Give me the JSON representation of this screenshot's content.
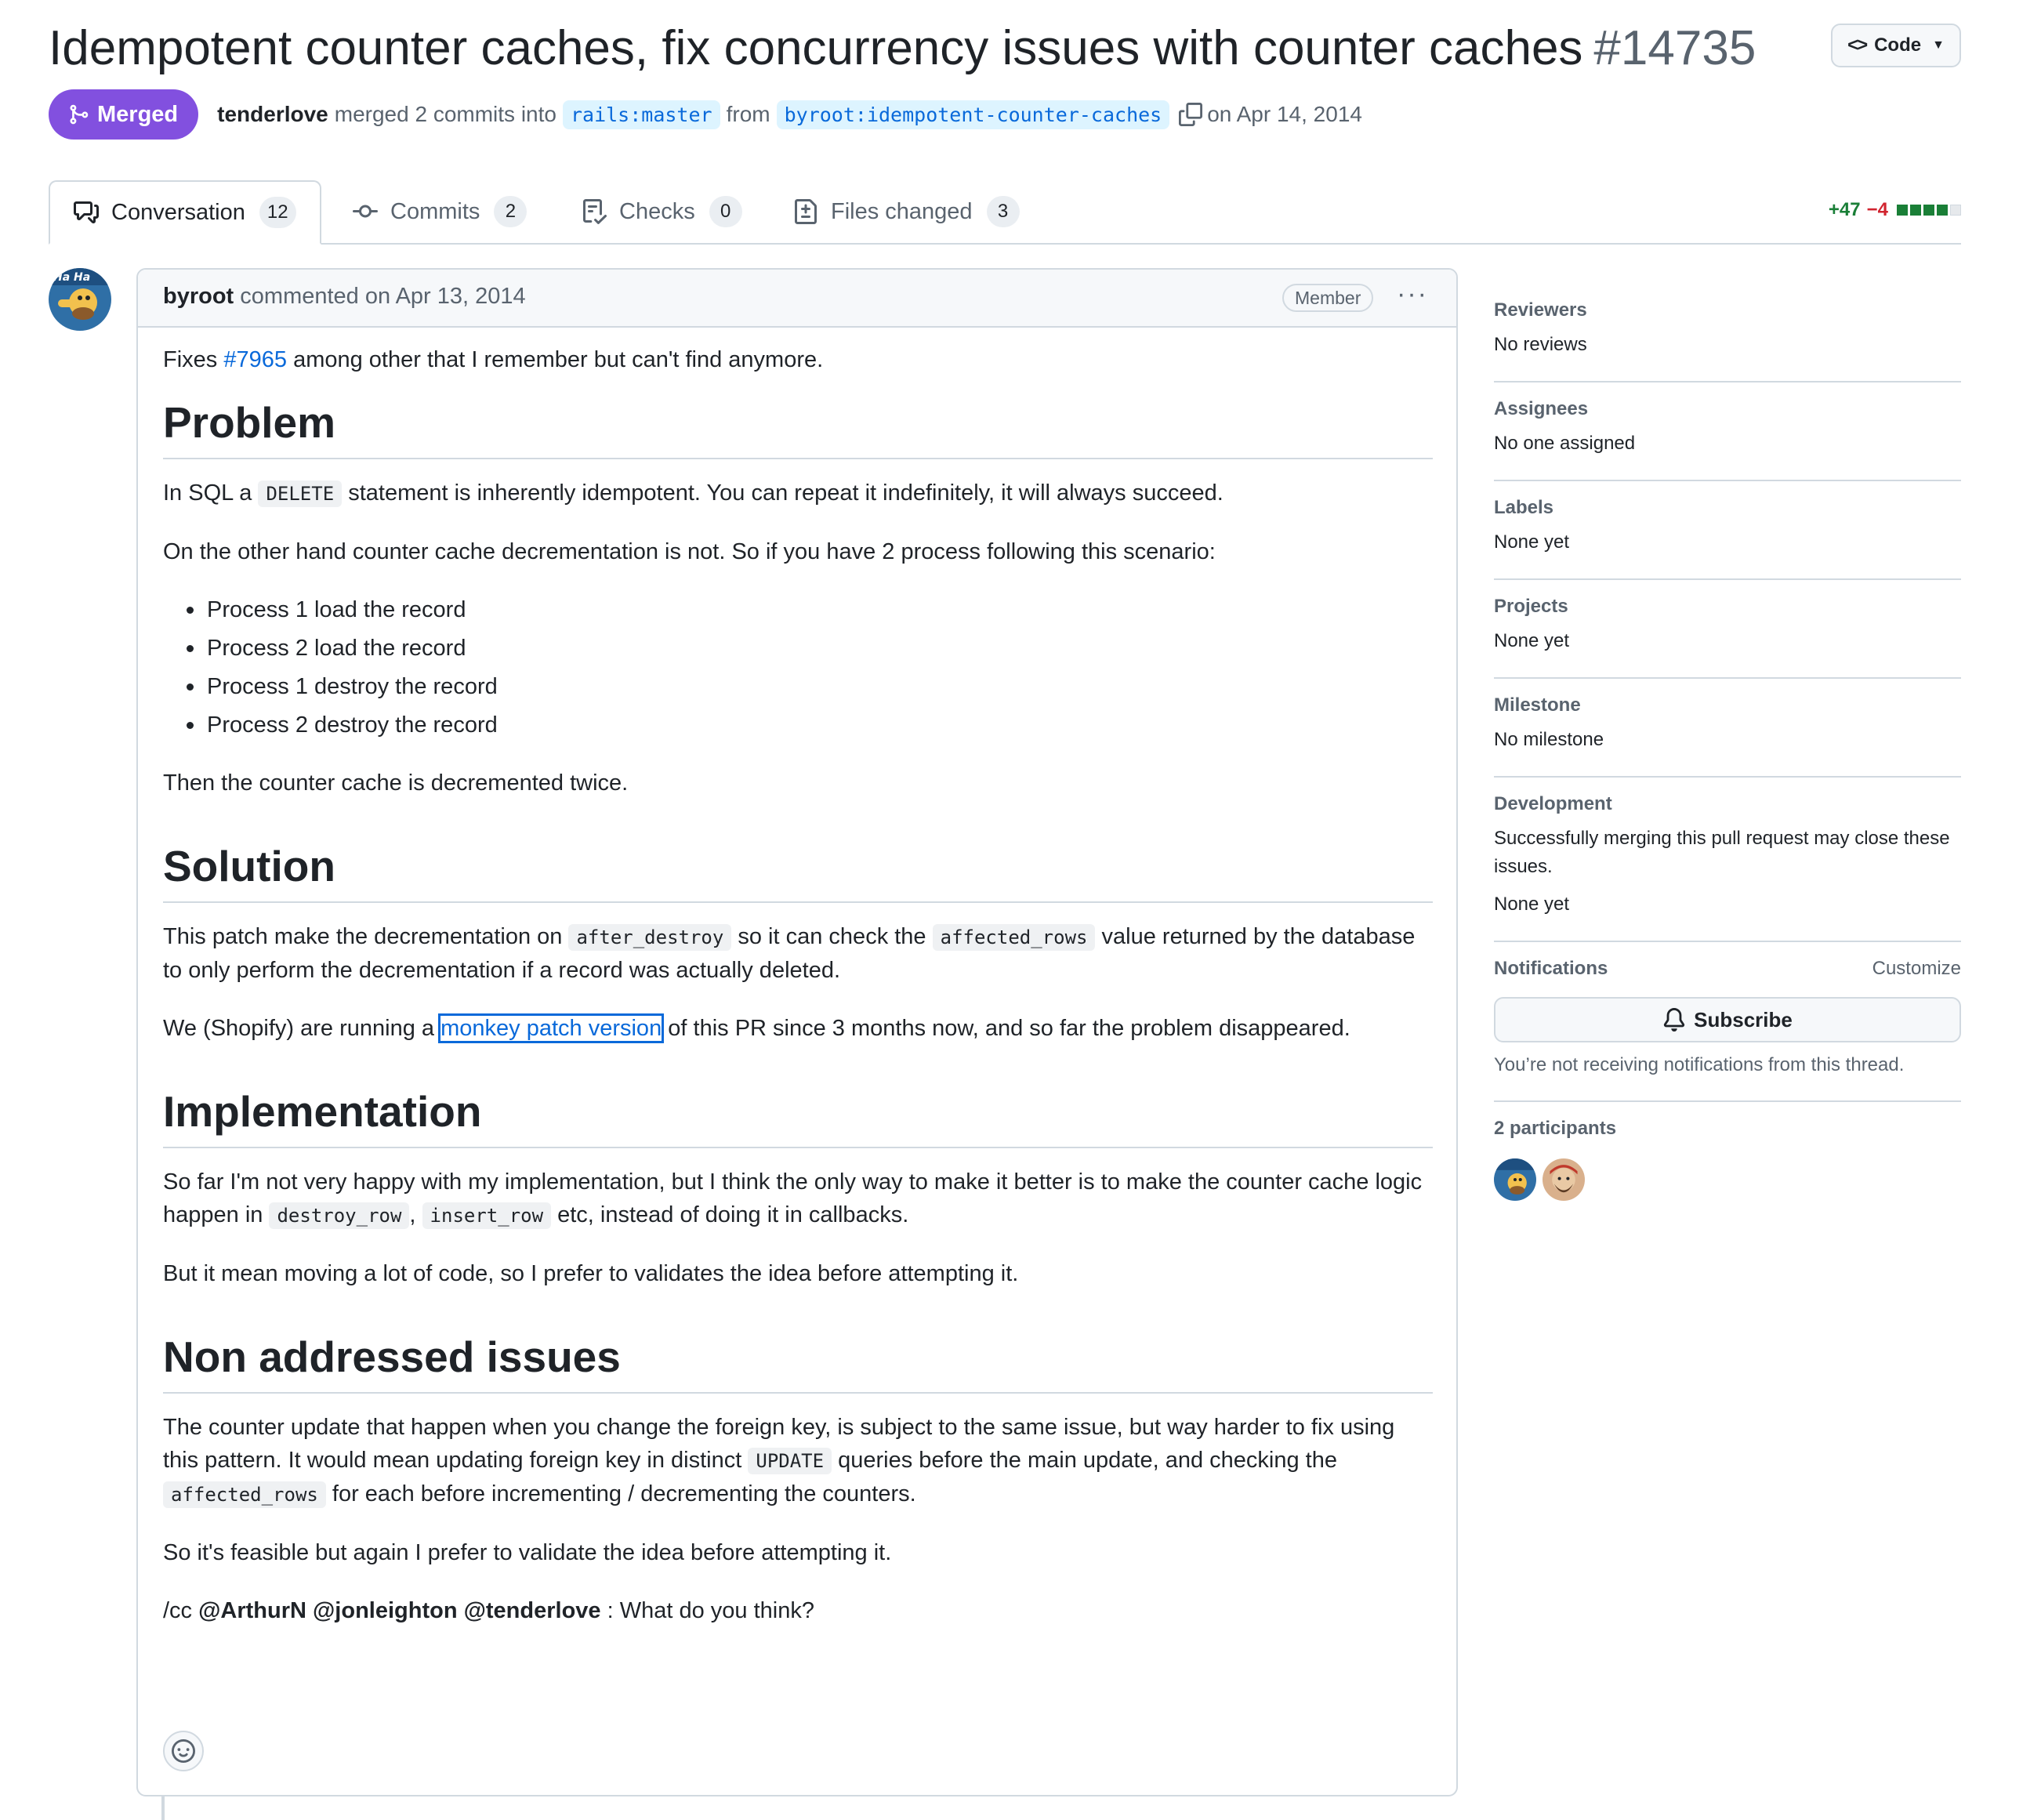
{
  "header": {
    "title": "Idempotent counter caches, fix concurrency issues with counter caches",
    "number": "#14735",
    "code_button": "Code",
    "state": "Merged",
    "merged_by": "tenderlove",
    "merged_text": "merged 2 commits into",
    "base_branch": "rails:master",
    "from_text": "from",
    "head_branch": "byroot:idempotent-counter-caches",
    "date_text": "on Apr 14, 2014"
  },
  "tabs": [
    {
      "label": "Conversation",
      "count": "12"
    },
    {
      "label": "Commits",
      "count": "2"
    },
    {
      "label": "Checks",
      "count": "0"
    },
    {
      "label": "Files changed",
      "count": "3"
    }
  ],
  "diffstat": {
    "additions": "+47",
    "deletions": "−4"
  },
  "colors": {
    "merged": "#8250df",
    "link": "#0969da",
    "add": "#1a7f37",
    "del": "#d1242f"
  },
  "comment": {
    "author": "byroot",
    "meta": "commented on Apr 13, 2014",
    "role": "Member",
    "intro_pre": "Fixes",
    "intro_link": "#7965",
    "intro_post": "among other that I remember but can't find anymore.",
    "problem_heading": "Problem",
    "problem_p1_pre": "In SQL a",
    "problem_p1_code": "DELETE",
    "problem_p1_post": "statement is inherently idempotent. You can repeat it indefinitely, it will always succeed.",
    "problem_p2": "On the other hand counter cache decrementation is not. So if you have 2 process following this scenario:",
    "steps": [
      "Process 1 load the record",
      "Process 2 load the record",
      "Process 1 destroy the record",
      "Process 2 destroy the record"
    ],
    "problem_p3": "Then the counter cache is decremented twice.",
    "solution_heading": "Solution",
    "solution_p1_a": "This patch make the decrementation on",
    "solution_p1_code1": "after_destroy",
    "solution_p1_b": "so it can check the",
    "solution_p1_code2": "affected_rows",
    "solution_p1_c": "value returned by the database to only perform the decrementation if a record was actually deleted.",
    "solution_p2_a": "We (Shopify) are running a",
    "solution_p2_link": "monkey patch version",
    "solution_p2_b": "of this PR since 3 months now, and so far the problem disappeared.",
    "impl_heading": "Implementation",
    "impl_p1_a": "So far I'm not very happy with my implementation, but I think the only way to make it better is to make the counter cache logic happen in",
    "impl_p1_code1": "destroy_row",
    "impl_p1_sep": ",",
    "impl_p1_code2": "insert_row",
    "impl_p1_b": "etc, instead of doing it in callbacks.",
    "impl_p2": "But it mean moving a lot of code, so I prefer to validates the idea before attempting it.",
    "non_heading": "Non addressed issues",
    "non_p1_a": "The counter update that happen when you change the foreign key, is subject to the same issue, but way harder to fix using this pattern. It would mean updating foreign key in distinct",
    "non_p1_code1": "UPDATE",
    "non_p1_b": "queries before the main update, and checking the",
    "non_p1_code2": "affected_rows",
    "non_p1_c": "for each before incrementing / decrementing the counters.",
    "non_p2": "So it's feasible but again I prefer to validate the idea before attempting it.",
    "cc_pre": "/cc",
    "mention1": "@ArthurN",
    "mention2": "@jonleighton",
    "mention3": "@tenderlove",
    "cc_post": ": What do you think?"
  },
  "sidebar": {
    "reviewers_title": "Reviewers",
    "reviewers_value": "No reviews",
    "assignees_title": "Assignees",
    "assignees_value": "No one assigned",
    "labels_title": "Labels",
    "labels_value": "None yet",
    "projects_title": "Projects",
    "projects_value": "None yet",
    "milestone_title": "Milestone",
    "milestone_value": "No milestone",
    "development_title": "Development",
    "development_desc": "Successfully merging this pull request may close these issues.",
    "development_value": "None yet",
    "notifications_title": "Notifications",
    "customize": "Customize",
    "subscribe": "Subscribe",
    "notifications_note": "You’re not receiving notifications from this thread.",
    "participants_title": "2 participants"
  }
}
